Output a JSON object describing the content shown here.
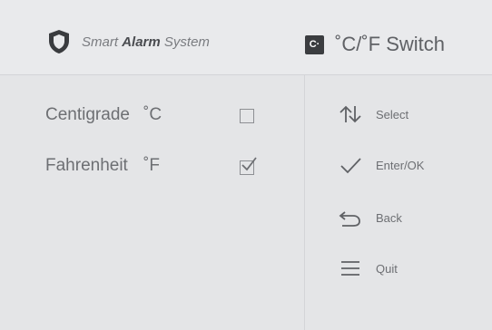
{
  "header": {
    "brand_prefix": "Smart",
    "brand_bold": "Alarm",
    "brand_suffix": "System",
    "title_icon": "C·",
    "title": "˚C/˚F Switch"
  },
  "options": [
    {
      "label": "Centigrade",
      "unit": "˚C",
      "checked": false
    },
    {
      "label": "Fahrenheit",
      "unit": "˚F",
      "checked": true
    }
  ],
  "keys": [
    {
      "icon": "up-down-arrows-icon",
      "label": "Select"
    },
    {
      "icon": "check-icon",
      "label": "Enter/OK"
    },
    {
      "icon": "back-arrow-icon",
      "label": "Back"
    },
    {
      "icon": "menu-icon",
      "label": "Quit"
    }
  ],
  "colors": {
    "background": "#e4e5e7",
    "text": "#6d6f73",
    "accent_dark": "#3b3d40"
  }
}
